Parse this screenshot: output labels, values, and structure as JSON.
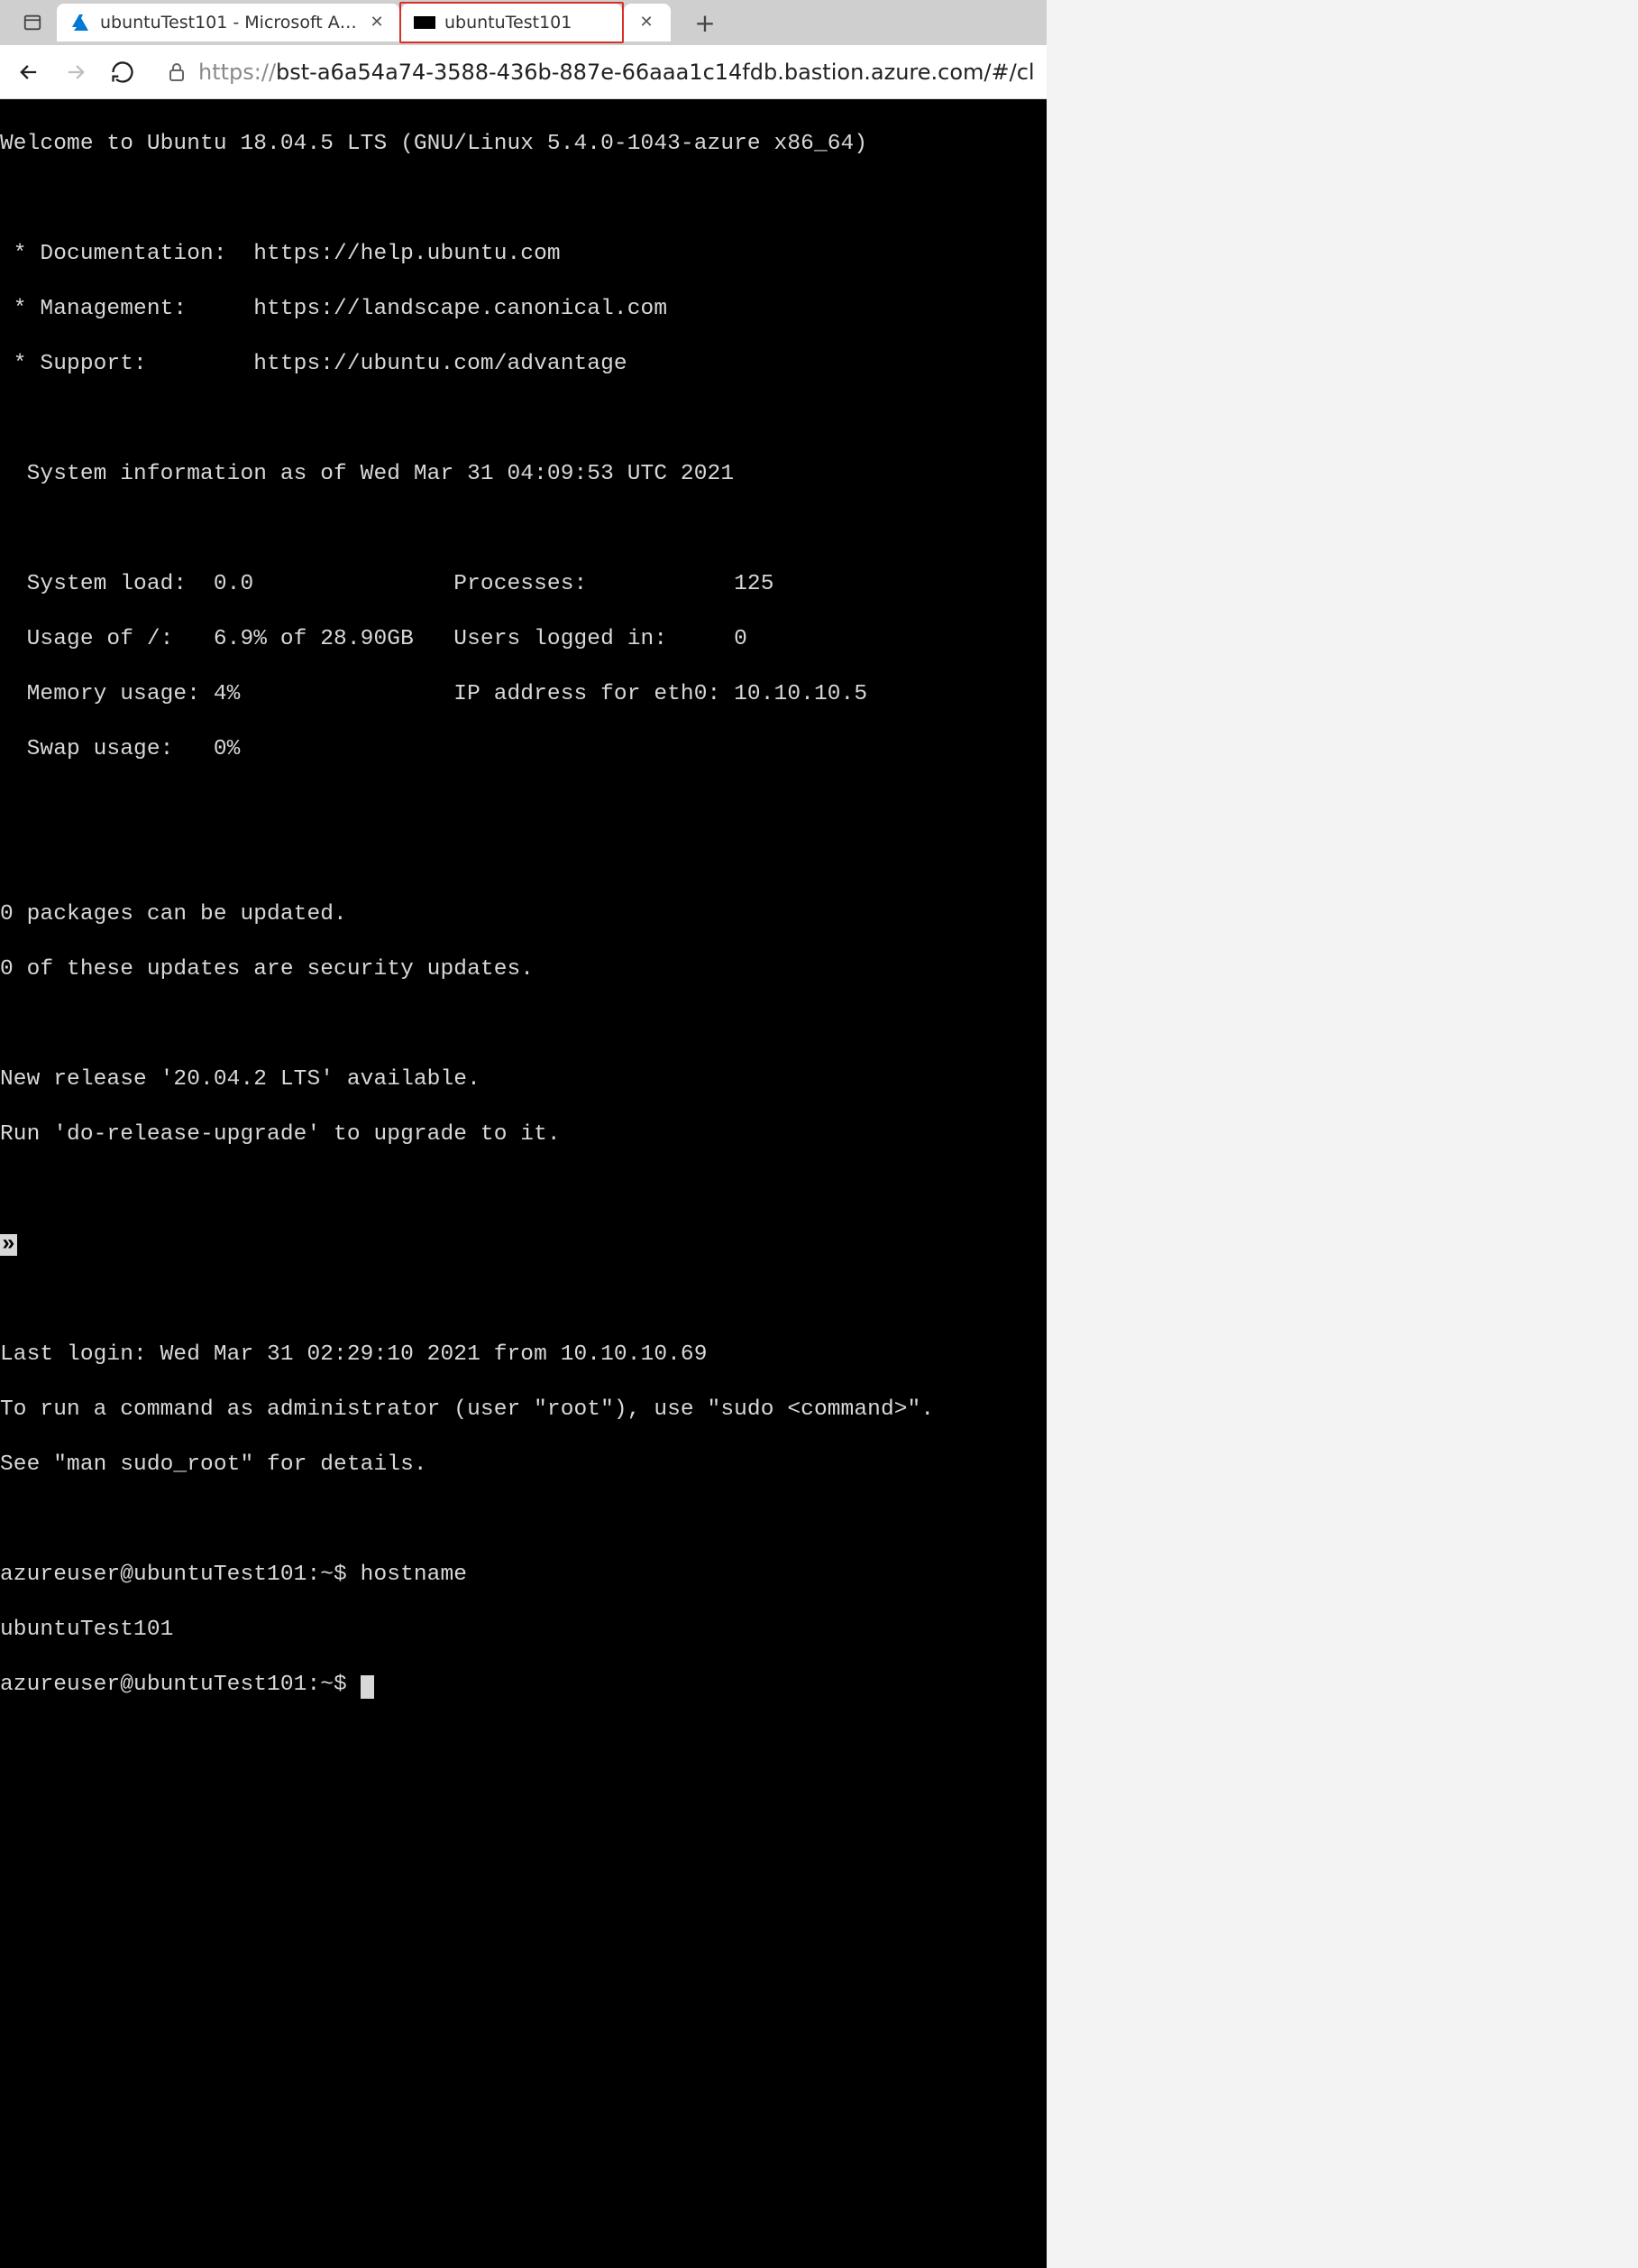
{
  "tabs": {
    "t0": {
      "title": "ubuntuTest101 - Microsoft Azure"
    },
    "t1": {
      "title": "ubuntuTest101"
    }
  },
  "url": {
    "scheme": "https://",
    "rest": "bst-a6a54a74-3588-436b-887e-66aaa1c14fdb.bastion.azure.com/#/cl"
  },
  "term": {
    "welcome": "Welcome to Ubuntu 18.04.5 LTS (GNU/Linux 5.4.0-1043-azure x86_64)",
    "doc": " * Documentation:  https://help.ubuntu.com",
    "mgmt": " * Management:     https://landscape.canonical.com",
    "sup": " * Support:        https://ubuntu.com/advantage",
    "sysinfo": "  System information as of Wed Mar 31 04:09:53 UTC 2021",
    "r1": "  System load:  0.0               Processes:           125",
    "r2": "  Usage of /:   6.9% of 28.90GB   Users logged in:     0",
    "r3": "  Memory usage: 4%                IP address for eth0: 10.10.10.5",
    "r4": "  Swap usage:   0%",
    "pkg1": "0 packages can be updated.",
    "pkg2": "0 of these updates are security updates.",
    "rel1": "New release '20.04.2 LTS' available.",
    "rel2": "Run 'do-release-upgrade' to upgrade to it.",
    "last": "Last login: Wed Mar 31 02:29:10 2021 from 10.10.10.69",
    "sudo1": "To run a command as administrator (user \"root\"), use \"sudo <command>\".",
    "sudo2": "See \"man sudo_root\" for details.",
    "prompt1": "azureuser@ubuntuTest101:~$ hostname",
    "host": "ubuntuTest101",
    "prompt2": "azureuser@ubuntuTest101:~$ "
  }
}
